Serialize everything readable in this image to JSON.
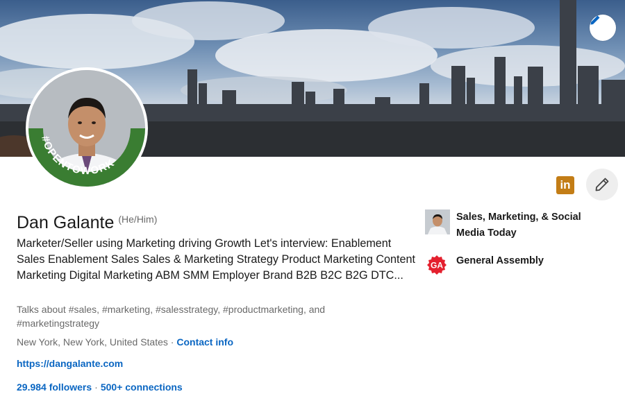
{
  "profile": {
    "name": "Dan Galante",
    "pronouns": "(He/Him)",
    "headline": "Marketer/Seller using Marketing driving Growth Let's interview: Enablement Sales Enablement Sales Sales & Marketing Strategy Product Marketing Content Marketing Digital Marketing ABM SMM Employer Brand B2B B2C B2G DTC...",
    "talks_about": "Talks about #sales, #marketing, #salesstrategy, #productmarketing, and #marketingstrategy",
    "location": "New York, New York, United States",
    "location_separator": "·",
    "contact_info": "Contact info",
    "website": "https://dangalante.com",
    "followers": "29.984 followers",
    "stats_separator": "·",
    "connections": "500+ connections",
    "open_to_work_badge": "#OPENTOWORK"
  },
  "actions": {
    "linkedin_badge_text": "in"
  },
  "experience": [
    {
      "label": "Sales, Marketing, & Social Media Today"
    },
    {
      "label": "General Assembly",
      "logo_text": "GA"
    }
  ],
  "colors": {
    "link": "#0a66c2",
    "open_to_work_ring": "#3a7d32",
    "linkedin_badge": "#c37d16",
    "general_assembly_red": "#e4202e"
  },
  "icons": {
    "banner_edit": "pencil-icon",
    "profile_edit": "pencil-icon"
  }
}
